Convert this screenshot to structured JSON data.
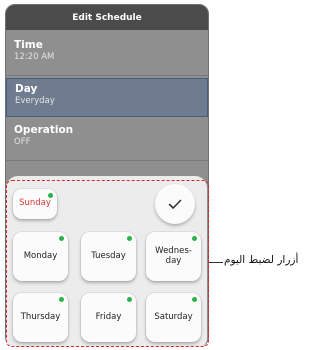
{
  "screen": {
    "title": "Edit Schedule",
    "rows": [
      {
        "label": "Time",
        "value": "12:20 AM"
      },
      {
        "label": "Day",
        "value": "Everyday"
      },
      {
        "label": "Operation",
        "value": "OFF"
      }
    ]
  },
  "days": {
    "sunday": "Sunday",
    "monday": "Monday",
    "tuesday": "Tuesday",
    "wednesday_line1": "Wednes-",
    "wednesday_line2": "day",
    "thursday": "Thursday",
    "friday": "Friday",
    "saturday": "Saturday"
  },
  "callout": "أزرار لضبط اليوم",
  "colors": {
    "selected_dot": "#2bb24c",
    "sunday_text": "#d23a3a",
    "highlight_dash": "#d42a2a"
  },
  "icons": {
    "confirm": "check-icon"
  }
}
